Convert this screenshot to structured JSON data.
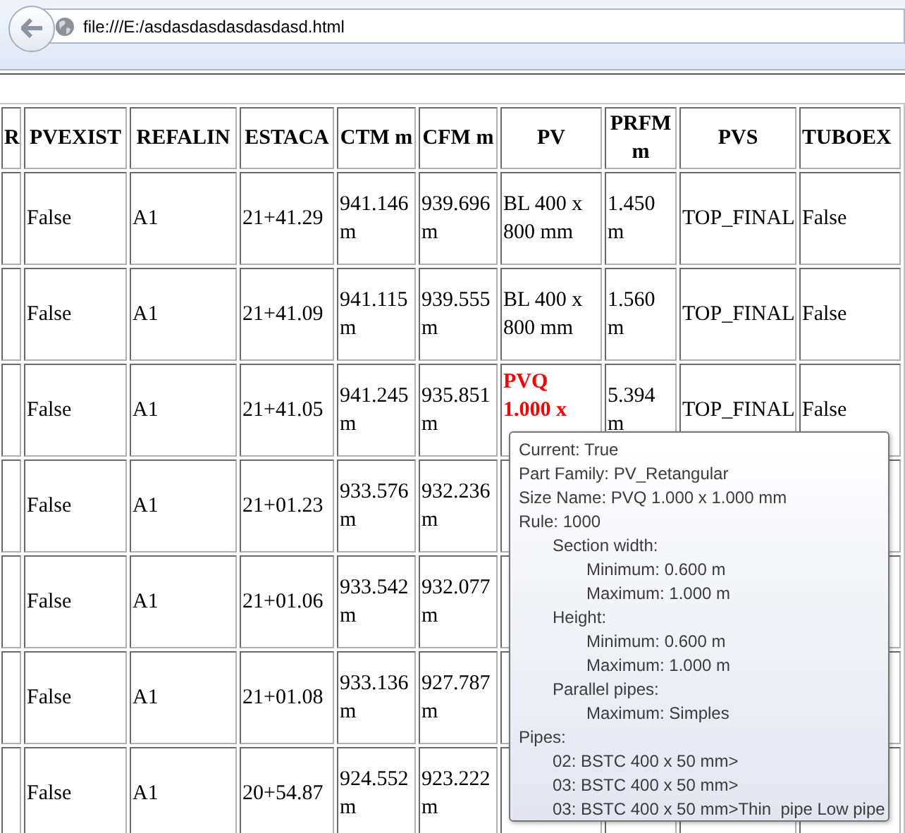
{
  "address_bar": {
    "url": "file:///E:/asdasdasdasdasdasd.html"
  },
  "table": {
    "columns": [
      "R",
      "PVEXIST",
      "REFALIN",
      "ESTACA",
      "CTM m",
      "CFM m",
      "PV",
      "PRFM m",
      "PVS",
      "TUBOEX"
    ],
    "rows": [
      {
        "pvexist": "False",
        "refalin": "A1",
        "estaca": "21+41.29",
        "ctm": "941.146 m",
        "cfm": "939.696 m",
        "pv_lines": [
          "BL 400 x",
          "800 mm"
        ],
        "pv_alert": false,
        "prfm": "1.450 m",
        "pvs": "TOP_FINAL",
        "tuboex": "False"
      },
      {
        "pvexist": "False",
        "refalin": "A1",
        "estaca": "21+41.09",
        "ctm": "941.115 m",
        "cfm": "939.555 m",
        "pv_lines": [
          "BL 400 x",
          "800 mm"
        ],
        "pv_alert": false,
        "prfm": "1.560 m",
        "pvs": "TOP_FINAL",
        "tuboex": "False"
      },
      {
        "pvexist": "False",
        "refalin": "A1",
        "estaca": "21+41.05",
        "ctm": "941.245 m",
        "cfm": "935.851 m",
        "pv_lines": [
          "PVQ",
          "1.000 x"
        ],
        "pv_alert": true,
        "prfm": "5.394 m",
        "pvs": "TOP_FINAL",
        "tuboex": "False"
      },
      {
        "pvexist": "False",
        "refalin": "A1",
        "estaca": "21+01.23",
        "ctm": "933.576 m",
        "cfm": "932.236 m"
      },
      {
        "pvexist": "False",
        "refalin": "A1",
        "estaca": "21+01.06",
        "ctm": "933.542 m",
        "cfm": "932.077 m"
      },
      {
        "pvexist": "False",
        "refalin": "A1",
        "estaca": "21+01.08",
        "ctm": "933.136 m",
        "cfm": "927.787 m"
      },
      {
        "pvexist": "False",
        "refalin": "A1",
        "estaca": "20+54.87",
        "ctm": "924.552 m",
        "cfm": "923.222 m"
      },
      {}
    ]
  },
  "tooltip": {
    "lines": [
      {
        "text": "Current: True"
      },
      {
        "text": "Part Family: PV_Retangular"
      },
      {
        "text": "Size Name: PVQ 1.000 x 1.000 mm"
      },
      {
        "text": "Rule: 1000",
        "children": [
          {
            "text": "Section width:",
            "children": [
              {
                "text": "Minimum: 0.600 m"
              },
              {
                "text": "Maximum: 1.000 m"
              }
            ]
          },
          {
            "text": "Height:",
            "children": [
              {
                "text": "Minimum: 0.600 m"
              },
              {
                "text": "Maximum: 1.000 m"
              }
            ]
          },
          {
            "text": "Parallel pipes:",
            "children": [
              {
                "text": "Maximum: Simples"
              }
            ]
          }
        ]
      },
      {
        "text": "Pipes:",
        "children": [
          {
            "text": "02: BSTC 400 x 50 mm>"
          },
          {
            "text": "03: BSTC 400 x 50 mm>"
          },
          {
            "text": "03: BSTC 400 x 50 mm>Thin  pipe Low pipe"
          }
        ]
      }
    ]
  }
}
